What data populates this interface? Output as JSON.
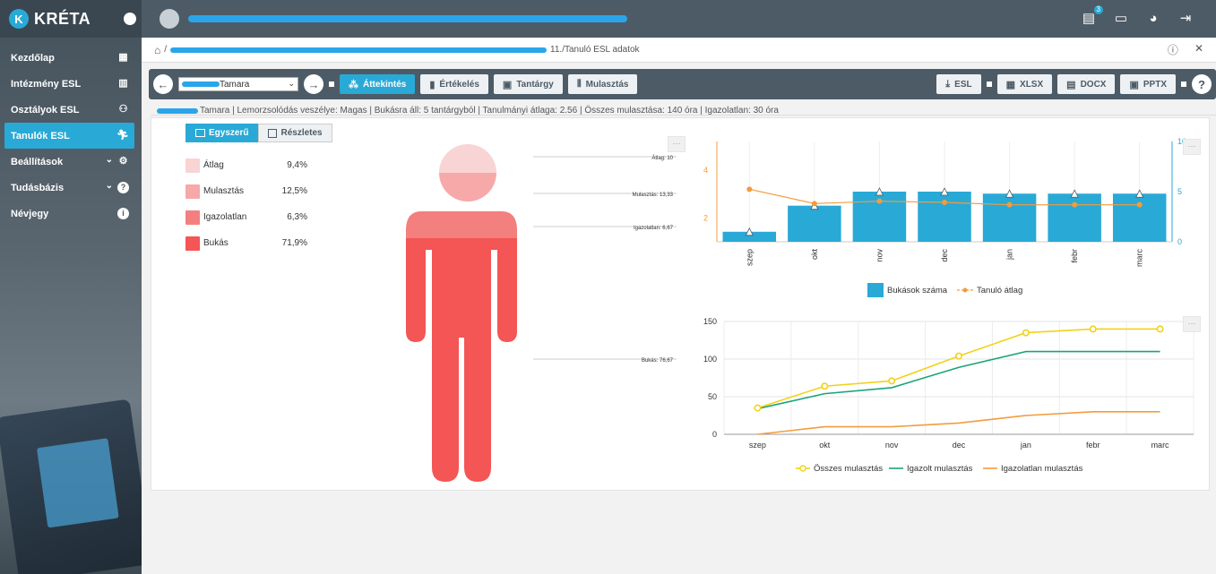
{
  "app": {
    "title": "KRÉTA"
  },
  "sidebar": {
    "items": [
      {
        "label": "Kezdőlap",
        "icon": "dashboard-icon",
        "active": false
      },
      {
        "label": "Intézmény ESL",
        "icon": "building-icon",
        "active": false
      },
      {
        "label": "Osztályok ESL",
        "icon": "group-icon",
        "active": false
      },
      {
        "label": "Tanulók ESL",
        "icon": "running-person-icon",
        "active": true
      },
      {
        "label": "Beállítások",
        "icon": "gear-icon",
        "active": false,
        "expandable": true
      },
      {
        "label": "Tudásbázis",
        "icon": "help-icon",
        "active": false,
        "expandable": true
      },
      {
        "label": "Névjegy",
        "icon": "info-icon",
        "active": false
      }
    ]
  },
  "topbar": {
    "notification_count": "3"
  },
  "breadcrumb": {
    "tail": "11./Tanuló ESL adatok"
  },
  "toolbar": {
    "student_name": "Tamara",
    "tabs": [
      {
        "label": "Áttekintés",
        "active": true
      },
      {
        "label": "Értékelés",
        "active": false
      },
      {
        "label": "Tantárgy",
        "active": false
      },
      {
        "label": "Mulasztás",
        "active": false
      }
    ],
    "exports": [
      "ESL",
      "XLSX",
      "DOCX",
      "PPTX"
    ]
  },
  "info": {
    "text": "Tamara | Lemorzsolódás veszélye: Magas | Bukásra áll: 5 tantárgyból | Tanulmányi átlaga: 2.56 | Összes mulasztása: 140 óra | Igazolatlan: 30 óra"
  },
  "view_toggle": {
    "simple": "Egyszerű",
    "detailed": "Részletes"
  },
  "risk_factors": [
    {
      "label": "Átlag",
      "value": "9,4%",
      "color": "#f9d4d4"
    },
    {
      "label": "Mulasztás",
      "value": "12,5%",
      "color": "#f7a8a8"
    },
    {
      "label": "Igazolatlan",
      "value": "6,3%",
      "color": "#f47f7f"
    },
    {
      "label": "Bukás",
      "value": "71,9%",
      "color": "#f45555"
    }
  ],
  "person_labels": {
    "atlag": "Átlag: 10",
    "mulasztas": "Mulasztás: 13,33",
    "igazolatlan": "Igazolatlan: 6,67",
    "bukas": "Bukás: 76,67"
  },
  "chart_data": [
    {
      "type": "bar",
      "categories": [
        "szep",
        "okt",
        "nov",
        "dec",
        "jan",
        "febr",
        "marc"
      ],
      "series": [
        {
          "name": "Bukások száma",
          "values": [
            1,
            3.6,
            5,
            5,
            4.8,
            4.8,
            4.8
          ],
          "color": "#29a9d6",
          "axis": "right"
        },
        {
          "name": "Tanuló átlag",
          "values": [
            3.2,
            2.6,
            2.7,
            2.65,
            2.55,
            2.55,
            2.55
          ],
          "color": "#f39c3d",
          "axis": "left",
          "kind": "line"
        }
      ],
      "left_ticks": [
        "2",
        "4"
      ],
      "right_ticks": [
        "0",
        "5",
        "10"
      ],
      "ylim_left": [
        1,
        5.2
      ],
      "ylim_right": [
        0,
        10
      ]
    },
    {
      "type": "line",
      "categories": [
        "szep",
        "okt",
        "nov",
        "dec",
        "jan",
        "febr",
        "marc"
      ],
      "series": [
        {
          "name": "Összes mulasztás",
          "values": [
            35,
            64,
            71,
            104,
            135,
            140,
            140
          ],
          "color": "#f2d21b",
          "markers": true
        },
        {
          "name": "Igazolt mulasztás",
          "values": [
            34,
            54,
            62,
            89,
            110,
            110,
            110
          ],
          "color": "#1aa37a"
        },
        {
          "name": "Igazolatlan mulasztás",
          "values": [
            0,
            10,
            10,
            15,
            25,
            30,
            30
          ],
          "color": "#f39c3d"
        }
      ],
      "y_ticks": [
        "0",
        "50",
        "100",
        "150"
      ],
      "ylim": [
        0,
        150
      ]
    }
  ]
}
